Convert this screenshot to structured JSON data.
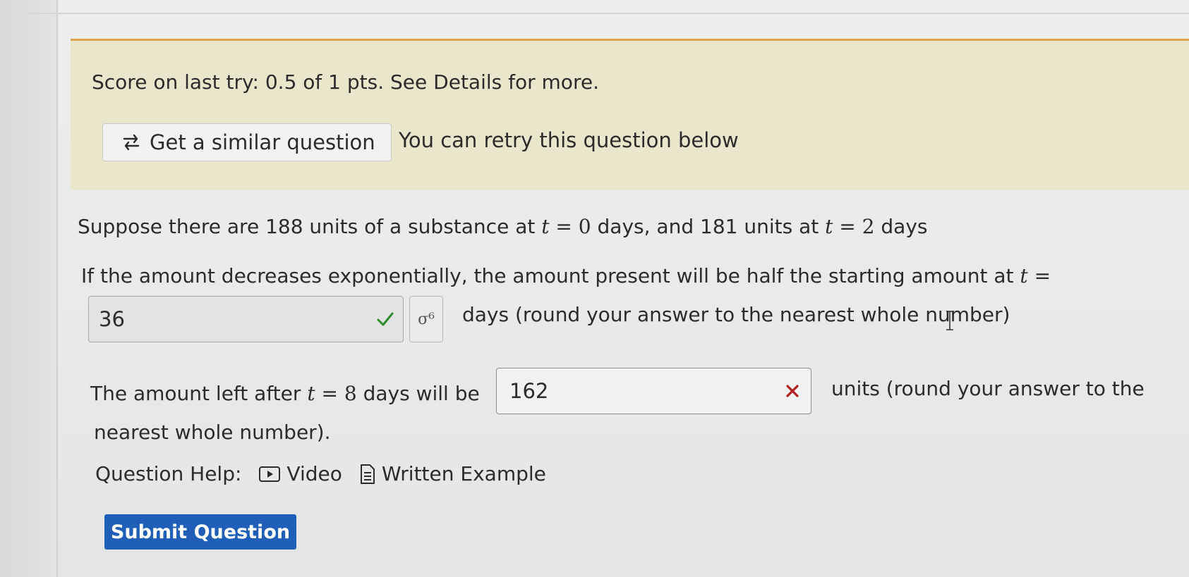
{
  "banner": {
    "score_text": "Score on last try: 0.5 of 1 pts. See Details for more.",
    "similar_button_label": "Get a similar question",
    "retry_note": "You can retry this question below"
  },
  "question": {
    "line1_a": "Suppose there are 188 units of a substance at",
    "t_var": "t",
    "eq": "=",
    "line1_t0": "0",
    "line1_b": "days, and 181 units at",
    "line1_t2": "2",
    "line1_c": "days",
    "line2_a": "If the amount decreases exponentially, the amount present will be half the starting amount at",
    "answer1_value": "36",
    "answer1_status": "correct",
    "preview_label": "σ⁶",
    "line3": "days (round your answer to the nearest whole number)",
    "line4_a": "The amount left after",
    "line4_t8": "8",
    "line4_b": "days will be",
    "answer2_value": "162",
    "answer2_status": "incorrect",
    "line4_c": "units (round your answer to the",
    "line5": "nearest whole number)."
  },
  "help": {
    "label": "Question Help:",
    "video_label": "Video",
    "example_label": "Written Example"
  },
  "submit_label": "Submit Question",
  "colors": {
    "banner_bg": "#e9e6cc",
    "banner_border": "#e0a24a",
    "submit_bg": "#1f5fb8",
    "correct": "#2e8b2e",
    "incorrect": "#b41e1e"
  }
}
